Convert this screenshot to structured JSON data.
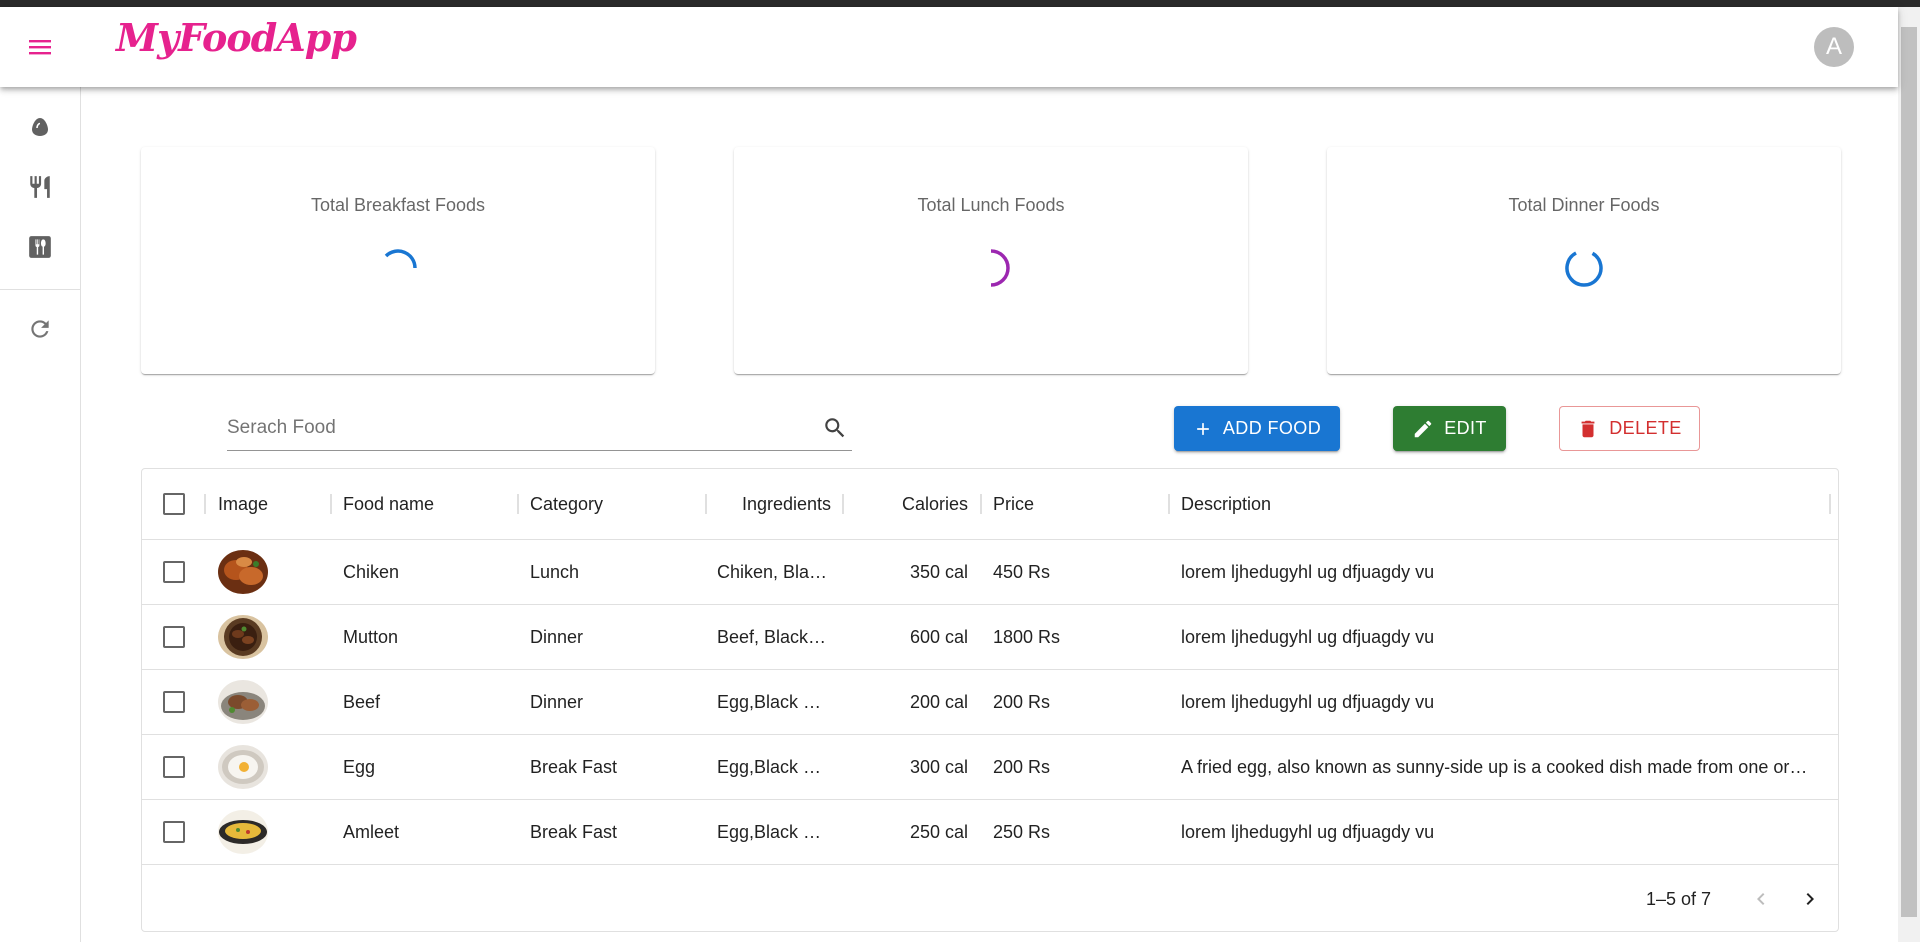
{
  "app": {
    "logo": "MyFoodApp",
    "avatar_initial": "A",
    "brand_color": "#e6228e"
  },
  "sidebar": {
    "items": [
      {
        "icon": "egg-icon"
      },
      {
        "icon": "restaurant-icon"
      },
      {
        "icon": "dining-icon"
      },
      {
        "icon": "refresh-icon"
      }
    ]
  },
  "stats": [
    {
      "label": "Total Breakfast Foods",
      "spinner_color": "#1976d2"
    },
    {
      "label": "Total Lunch Foods",
      "spinner_color": "#9c27b0"
    },
    {
      "label": "Total Dinner Foods",
      "spinner_color": "#1976d2"
    }
  ],
  "search": {
    "placeholder": "Serach Food",
    "value": ""
  },
  "actions": {
    "add": "ADD FOOD",
    "edit": "EDIT",
    "delete": "DELETE"
  },
  "table": {
    "columns": [
      "Image",
      "Food name",
      "Category",
      "Ingredients",
      "Calories",
      "Price",
      "Description"
    ],
    "rows": [
      {
        "image": "chicken-dish-image",
        "name": "Chiken",
        "category": "Lunch",
        "ingredients": "Chiken, Bla…",
        "calories": "350 cal",
        "price": "450 Rs",
        "description": "lorem ljhedugyhl ug dfjuagdy vu"
      },
      {
        "image": "mutton-dish-image",
        "name": "Mutton",
        "category": "Dinner",
        "ingredients": "Beef, Black…",
        "calories": "600 cal",
        "price": "1800 Rs",
        "description": "lorem ljhedugyhl ug dfjuagdy vu"
      },
      {
        "image": "beef-dish-image",
        "name": "Beef",
        "category": "Dinner",
        "ingredients": "Egg,Black …",
        "calories": "200 cal",
        "price": "200 Rs",
        "description": "lorem ljhedugyhl ug dfjuagdy vu"
      },
      {
        "image": "egg-dish-image",
        "name": "Egg",
        "category": "Break Fast",
        "ingredients": "Egg,Black …",
        "calories": "300 cal",
        "price": "200 Rs",
        "description": "A fried egg, also known as sunny-side up is a cooked dish made from one or …"
      },
      {
        "image": "omelette-dish-image",
        "name": "Amleet",
        "category": "Break Fast",
        "ingredients": "Egg,Black …",
        "calories": "250 cal",
        "price": "250 Rs",
        "description": "lorem ljhedugyhl ug dfjuagdy vu"
      }
    ]
  },
  "pagination": {
    "range": "1–5 of 7"
  }
}
